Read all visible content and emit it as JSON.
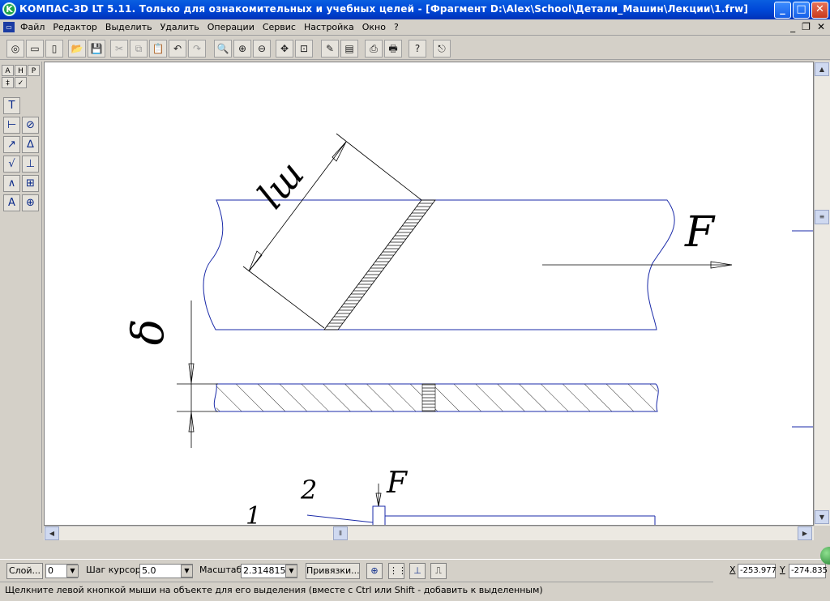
{
  "window": {
    "title": "КОМПАС-3D LT 5.11. Только для ознакомительных и учебных целей - [Фрагмент D:\\Alex\\School\\Детали_Машин\\Лекции\\1.frw]",
    "icon_letter": "K",
    "minimize": "_",
    "maximize": "□",
    "close": "✕"
  },
  "menu": {
    "items": [
      "Файл",
      "Редактор",
      "Выделить",
      "Удалить",
      "Операции",
      "Сервис",
      "Настройка",
      "Окно",
      "?"
    ],
    "mdi_minimize": "_",
    "mdi_restore": "❐",
    "mdi_close": "✕"
  },
  "toolbar": {
    "buttons": [
      {
        "name": "new-model-icon",
        "glyph": "◎"
      },
      {
        "name": "new-drawing-icon",
        "glyph": "▭"
      },
      {
        "name": "new-fragment-icon",
        "glyph": "▯"
      },
      {
        "name": "open-icon",
        "glyph": "📂"
      },
      {
        "name": "save-icon",
        "glyph": "💾"
      },
      {
        "name": "cut-icon",
        "glyph": "✂"
      },
      {
        "name": "copy-icon",
        "glyph": "⧉"
      },
      {
        "name": "paste-icon",
        "glyph": "📋"
      },
      {
        "name": "undo-icon",
        "glyph": "↶"
      },
      {
        "name": "redo-icon",
        "glyph": "↷"
      },
      {
        "name": "zoom-icon",
        "glyph": "🔍"
      },
      {
        "name": "zoom-in-icon",
        "glyph": "⊕"
      },
      {
        "name": "zoom-out-icon",
        "glyph": "⊖"
      },
      {
        "name": "pan-icon",
        "glyph": "✥"
      },
      {
        "name": "zoom-fit-icon",
        "glyph": "⊡"
      },
      {
        "name": "edit-icon",
        "glyph": "✎"
      },
      {
        "name": "layer-icon",
        "glyph": "▤"
      },
      {
        "name": "preview-icon",
        "glyph": "⎙"
      },
      {
        "name": "print-icon",
        "glyph": "🖶"
      },
      {
        "name": "help-icon",
        "glyph": "?"
      },
      {
        "name": "exit-icon",
        "glyph": "⎋"
      }
    ]
  },
  "left_tools": {
    "tabs": [
      "A",
      "H",
      "P",
      "‡",
      "✓"
    ],
    "buttons": [
      {
        "name": "text-tool-icon",
        "glyph": "T"
      },
      {
        "name": "linear-dimension-icon",
        "glyph": "⊢"
      },
      {
        "name": "diameter-dimension-icon",
        "glyph": "⊘"
      },
      {
        "name": "radial-dimension-icon",
        "glyph": "↗"
      },
      {
        "name": "angular-dimension-icon",
        "glyph": "∆"
      },
      {
        "name": "roughness-icon",
        "glyph": "√"
      },
      {
        "name": "datum-icon",
        "glyph": "⊥"
      },
      {
        "name": "leader-icon",
        "glyph": "∧"
      },
      {
        "name": "tolerance-icon",
        "glyph": "⊞"
      },
      {
        "name": "label-icon",
        "glyph": "A"
      },
      {
        "name": "axis-icon",
        "glyph": "⊕"
      }
    ]
  },
  "drawing": {
    "label_F_top": "F",
    "label_le": "lш",
    "label_delta": "δ",
    "label_2": "2",
    "label_F_small": "F",
    "label_1": "1"
  },
  "status": {
    "layer_button": "Слой...",
    "layer_value": "0",
    "cursor_step_label": "Шаг курсора",
    "cursor_step_value": "5.0",
    "scale_label": "Масштаб",
    "scale_value": "2.314815",
    "snaps_button": "Привязки...",
    "x_label": "X",
    "x_value": "-253.977",
    "y_label": "Y",
    "y_value": "-274.835",
    "hint": "Щелкните левой кнопкой мыши на объекте для его выделения (вместе с Ctrl или Shift - добавить к выделенным)"
  }
}
